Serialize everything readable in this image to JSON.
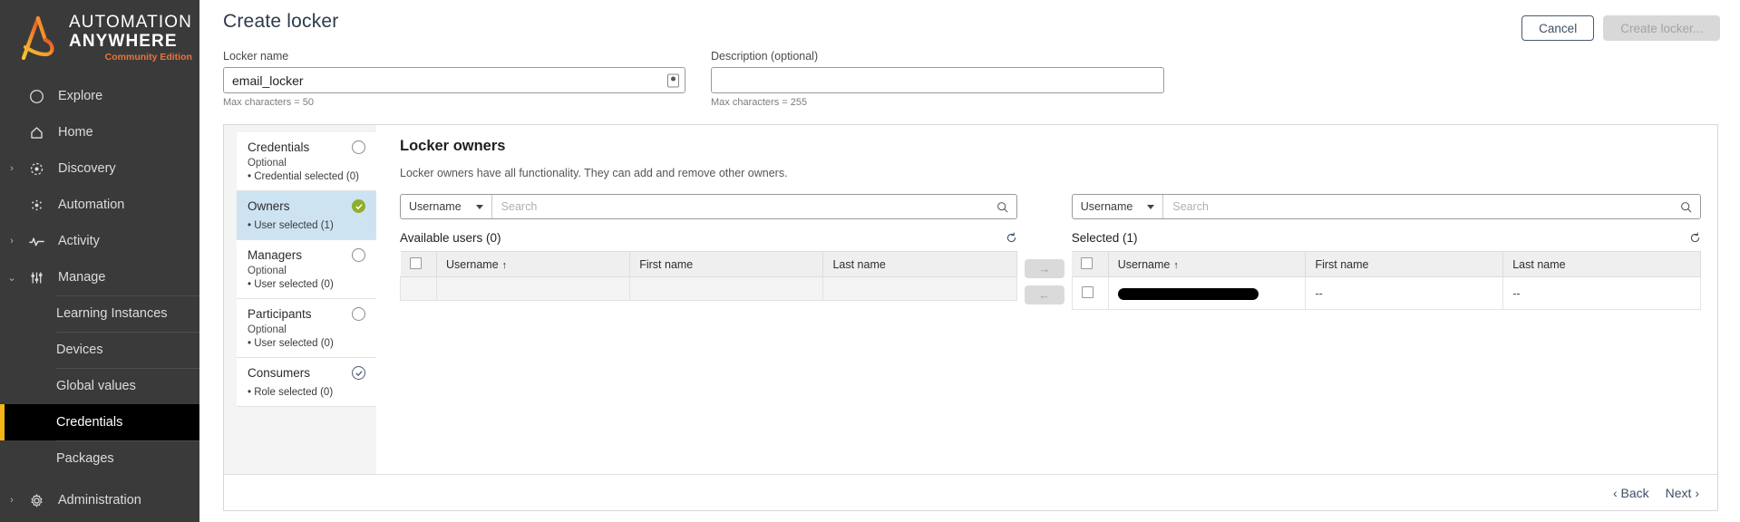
{
  "brand": {
    "line1": "AUTOMATION",
    "line2": "ANYWHERE",
    "line3": "Community Edition",
    "accent": "#e8743b",
    "highlight": "#f5b417"
  },
  "sidebar": {
    "items": [
      {
        "label": "Explore",
        "icon": "compass-icon",
        "caret": "",
        "type": "top"
      },
      {
        "label": "Home",
        "icon": "home-icon",
        "caret": "",
        "type": "top"
      },
      {
        "label": "Discovery",
        "icon": "discovery-icon",
        "caret": "›",
        "type": "top"
      },
      {
        "label": "Automation",
        "icon": "automation-icon",
        "caret": "",
        "type": "top"
      },
      {
        "label": "Activity",
        "icon": "activity-icon",
        "caret": "›",
        "type": "top"
      },
      {
        "label": "Manage",
        "icon": "sliders-icon",
        "caret": "⌄",
        "type": "top"
      }
    ],
    "sub_items": [
      {
        "label": "Learning Instances",
        "active": false
      },
      {
        "label": "Devices",
        "active": false
      },
      {
        "label": "Global values",
        "active": false
      },
      {
        "label": "Credentials",
        "active": true
      },
      {
        "label": "Packages",
        "active": false
      }
    ],
    "admin": {
      "label": "Administration",
      "icon": "gear-icon",
      "caret": "›"
    }
  },
  "header": {
    "title": "Create locker",
    "cancel_label": "Cancel",
    "create_label": "Create locker..."
  },
  "form": {
    "locker_name": {
      "label": "Locker name",
      "value": "email_locker",
      "placeholder": "",
      "hint": "Max characters = 50"
    },
    "description": {
      "label": "Description (optional)",
      "value": "",
      "placeholder": "",
      "hint": "Max characters = 255"
    }
  },
  "steps": [
    {
      "title": "Credentials",
      "optional": "Optional",
      "sub": "• Credential selected (0)",
      "state": "empty",
      "selected": false
    },
    {
      "title": "Owners",
      "optional": "",
      "sub": "• User selected (1)",
      "state": "complete",
      "selected": true
    },
    {
      "title": "Managers",
      "optional": "Optional",
      "sub": "• User selected (0)",
      "state": "empty",
      "selected": false
    },
    {
      "title": "Participants",
      "optional": "Optional",
      "sub": "• User selected (0)",
      "state": "empty",
      "selected": false
    },
    {
      "title": "Consumers",
      "optional": "",
      "sub": "• Role selected (0)",
      "state": "checked",
      "selected": false
    }
  ],
  "content": {
    "title": "Locker owners",
    "description": "Locker owners have all functionality. They can add and remove other owners."
  },
  "available": {
    "filter_label": "Username",
    "search_placeholder": "Search",
    "search_value": "",
    "list_title": "Available users  (0)",
    "columns": [
      "Username",
      "First name",
      "Last name"
    ],
    "sort_column": "Username",
    "sort_arrow": "↑",
    "rows": []
  },
  "selected": {
    "filter_label": "Username",
    "search_placeholder": "Search",
    "search_value": "",
    "list_title": "Selected  (1)",
    "columns": [
      "Username",
      "First name",
      "Last name"
    ],
    "sort_column": "Username",
    "sort_arrow": "↑",
    "rows": [
      {
        "username": "",
        "username_redacted": true,
        "first_name": "--",
        "last_name": "--"
      }
    ]
  },
  "transfer": {
    "add_label": "→",
    "remove_label": "←"
  },
  "footer": {
    "back_label": "‹ Back",
    "next_label": "Next ›"
  }
}
